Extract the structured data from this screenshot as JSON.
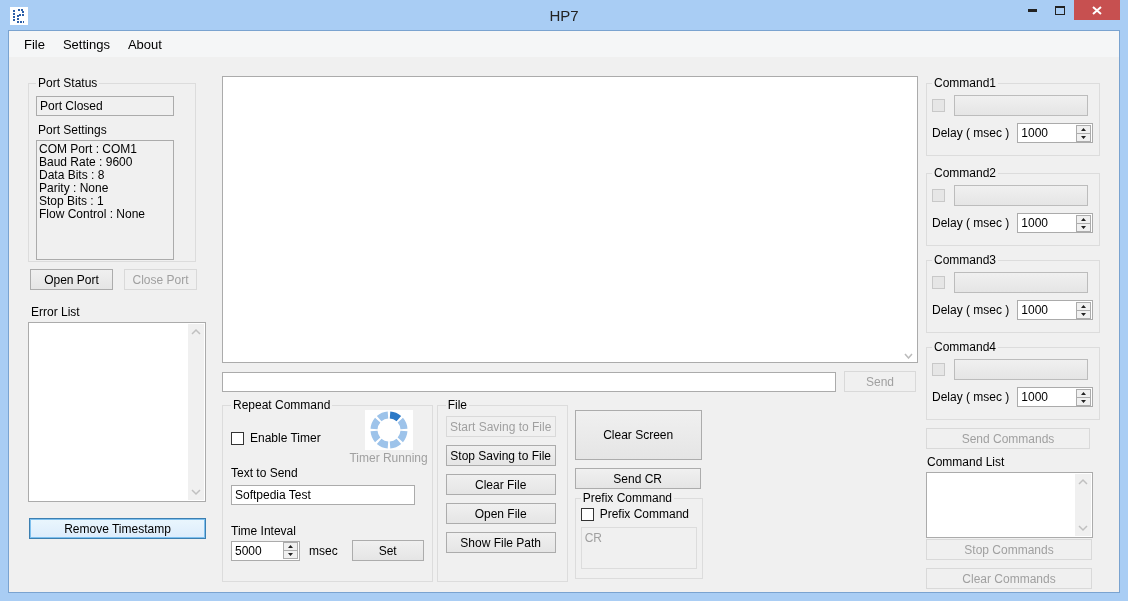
{
  "window": {
    "title": "HP7"
  },
  "menu": [
    {
      "label": "File"
    },
    {
      "label": "Settings"
    },
    {
      "label": "About"
    }
  ],
  "port_status": {
    "title": "Port Status",
    "status": "Port Closed",
    "settings_label": "Port Settings",
    "settings_lines": [
      "COM Port : COM1",
      "Baud Rate : 9600",
      "Data Bits : 8",
      "Parity : None",
      "Stop Bits : 1",
      "Flow Control : None"
    ]
  },
  "port_buttons": [
    {
      "label": "Open Port",
      "disabled": false
    },
    {
      "label": "Close Port",
      "disabled": true
    }
  ],
  "error_list": {
    "label": "Error List"
  },
  "remove_timestamp": {
    "label": "Remove Timestamp",
    "focused": true
  },
  "send": {
    "label": "Send",
    "disabled": true
  },
  "repeat_command": {
    "title": "Repeat Command",
    "enable_timer": {
      "label": "Enable Timer",
      "checked": false
    },
    "timer_status": {
      "label": "Timer Running",
      "disabled": true
    },
    "text_label": "Text to Send",
    "text_value": "Softpedia Test",
    "interval_label": "Time Inteval",
    "interval_value": "5000",
    "unit": "msec",
    "set_button": "Set"
  },
  "file": {
    "title": "File",
    "buttons": [
      {
        "label": "Start Saving to File",
        "disabled": true
      },
      {
        "label": "Stop Saving to File",
        "disabled": false
      },
      {
        "label": "Clear File",
        "disabled": false
      },
      {
        "label": "Open File",
        "disabled": false
      },
      {
        "label": "Show File Path",
        "disabled": false
      }
    ]
  },
  "clear_screen": {
    "label": "Clear Screen"
  },
  "send_cr": {
    "label": "Send CR"
  },
  "prefix": {
    "title": "Prefix Command",
    "checkbox": {
      "label": "Prefix Command",
      "checked": false
    },
    "value": "CR",
    "disabled": true
  },
  "commands": [
    {
      "title": "Command1",
      "checked": false,
      "disabled": true,
      "delay_label": "Delay ( msec )",
      "delay": "1000"
    },
    {
      "title": "Command2",
      "checked": false,
      "disabled": true,
      "delay_label": "Delay ( msec )",
      "delay": "1000"
    },
    {
      "title": "Command3",
      "checked": false,
      "disabled": true,
      "delay_label": "Delay ( msec )",
      "delay": "1000"
    },
    {
      "title": "Command4",
      "checked": false,
      "disabled": true,
      "delay_label": "Delay ( msec )",
      "delay": "1000"
    }
  ],
  "send_commands": {
    "label": "Send Commands",
    "disabled": true
  },
  "command_list": {
    "label": "Command List"
  },
  "stop_commands": {
    "label": "Stop Commands",
    "disabled": true
  },
  "clear_commands": {
    "label": "Clear Commands",
    "disabled": true
  }
}
